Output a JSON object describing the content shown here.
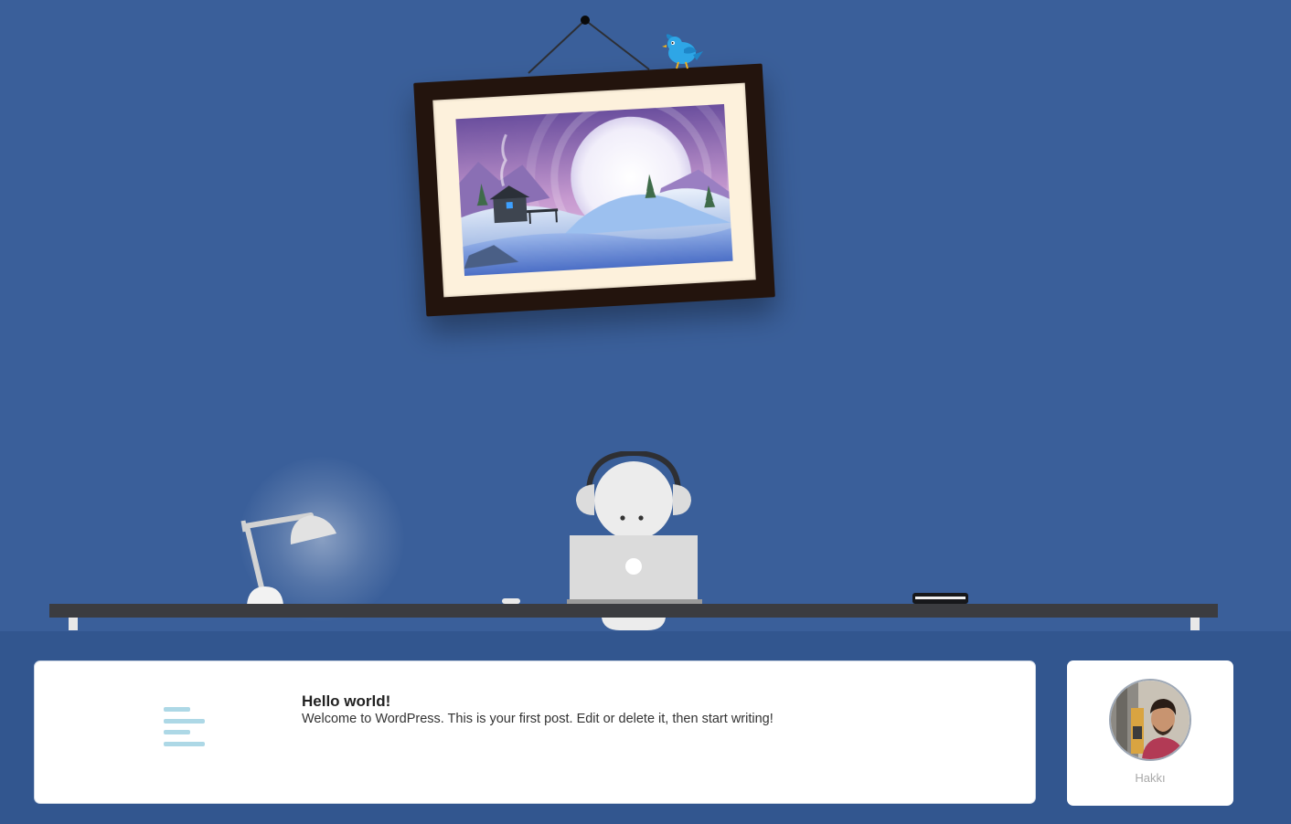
{
  "post": {
    "title": "Hello world!",
    "excerpt": "Welcome to WordPress. This is your first post. Edit or delete it, then start writing!",
    "icon": "post-lines-icon"
  },
  "author": {
    "name": "Hakkı"
  },
  "colors": {
    "wall": "#3a5f9a",
    "footer": "#32568f",
    "desk": "#3b3c40",
    "frame": "#23140d",
    "mat": "#fdf1dc",
    "post_icon": "#add8e6",
    "bird": "#2ea6e6"
  }
}
